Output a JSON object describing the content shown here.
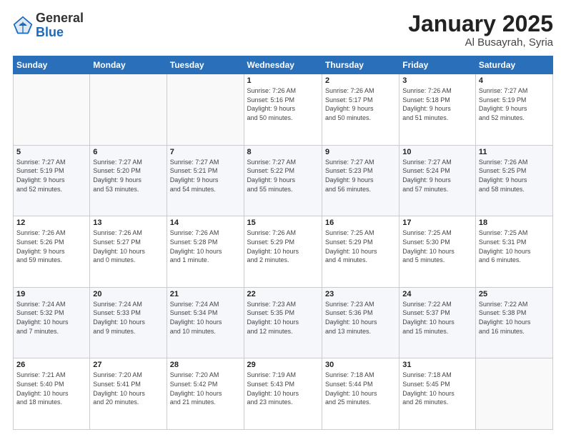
{
  "header": {
    "logo_general": "General",
    "logo_blue": "Blue",
    "title": "January 2025",
    "subtitle": "Al Busayrah, Syria"
  },
  "days_of_week": [
    "Sunday",
    "Monday",
    "Tuesday",
    "Wednesday",
    "Thursday",
    "Friday",
    "Saturday"
  ],
  "weeks": [
    [
      {
        "day": "",
        "info": ""
      },
      {
        "day": "",
        "info": ""
      },
      {
        "day": "",
        "info": ""
      },
      {
        "day": "1",
        "info": "Sunrise: 7:26 AM\nSunset: 5:16 PM\nDaylight: 9 hours\nand 50 minutes."
      },
      {
        "day": "2",
        "info": "Sunrise: 7:26 AM\nSunset: 5:17 PM\nDaylight: 9 hours\nand 50 minutes."
      },
      {
        "day": "3",
        "info": "Sunrise: 7:26 AM\nSunset: 5:18 PM\nDaylight: 9 hours\nand 51 minutes."
      },
      {
        "day": "4",
        "info": "Sunrise: 7:27 AM\nSunset: 5:19 PM\nDaylight: 9 hours\nand 52 minutes."
      }
    ],
    [
      {
        "day": "5",
        "info": "Sunrise: 7:27 AM\nSunset: 5:19 PM\nDaylight: 9 hours\nand 52 minutes."
      },
      {
        "day": "6",
        "info": "Sunrise: 7:27 AM\nSunset: 5:20 PM\nDaylight: 9 hours\nand 53 minutes."
      },
      {
        "day": "7",
        "info": "Sunrise: 7:27 AM\nSunset: 5:21 PM\nDaylight: 9 hours\nand 54 minutes."
      },
      {
        "day": "8",
        "info": "Sunrise: 7:27 AM\nSunset: 5:22 PM\nDaylight: 9 hours\nand 55 minutes."
      },
      {
        "day": "9",
        "info": "Sunrise: 7:27 AM\nSunset: 5:23 PM\nDaylight: 9 hours\nand 56 minutes."
      },
      {
        "day": "10",
        "info": "Sunrise: 7:27 AM\nSunset: 5:24 PM\nDaylight: 9 hours\nand 57 minutes."
      },
      {
        "day": "11",
        "info": "Sunrise: 7:26 AM\nSunset: 5:25 PM\nDaylight: 9 hours\nand 58 minutes."
      }
    ],
    [
      {
        "day": "12",
        "info": "Sunrise: 7:26 AM\nSunset: 5:26 PM\nDaylight: 9 hours\nand 59 minutes."
      },
      {
        "day": "13",
        "info": "Sunrise: 7:26 AM\nSunset: 5:27 PM\nDaylight: 10 hours\nand 0 minutes."
      },
      {
        "day": "14",
        "info": "Sunrise: 7:26 AM\nSunset: 5:28 PM\nDaylight: 10 hours\nand 1 minute."
      },
      {
        "day": "15",
        "info": "Sunrise: 7:26 AM\nSunset: 5:29 PM\nDaylight: 10 hours\nand 2 minutes."
      },
      {
        "day": "16",
        "info": "Sunrise: 7:25 AM\nSunset: 5:29 PM\nDaylight: 10 hours\nand 4 minutes."
      },
      {
        "day": "17",
        "info": "Sunrise: 7:25 AM\nSunset: 5:30 PM\nDaylight: 10 hours\nand 5 minutes."
      },
      {
        "day": "18",
        "info": "Sunrise: 7:25 AM\nSunset: 5:31 PM\nDaylight: 10 hours\nand 6 minutes."
      }
    ],
    [
      {
        "day": "19",
        "info": "Sunrise: 7:24 AM\nSunset: 5:32 PM\nDaylight: 10 hours\nand 7 minutes."
      },
      {
        "day": "20",
        "info": "Sunrise: 7:24 AM\nSunset: 5:33 PM\nDaylight: 10 hours\nand 9 minutes."
      },
      {
        "day": "21",
        "info": "Sunrise: 7:24 AM\nSunset: 5:34 PM\nDaylight: 10 hours\nand 10 minutes."
      },
      {
        "day": "22",
        "info": "Sunrise: 7:23 AM\nSunset: 5:35 PM\nDaylight: 10 hours\nand 12 minutes."
      },
      {
        "day": "23",
        "info": "Sunrise: 7:23 AM\nSunset: 5:36 PM\nDaylight: 10 hours\nand 13 minutes."
      },
      {
        "day": "24",
        "info": "Sunrise: 7:22 AM\nSunset: 5:37 PM\nDaylight: 10 hours\nand 15 minutes."
      },
      {
        "day": "25",
        "info": "Sunrise: 7:22 AM\nSunset: 5:38 PM\nDaylight: 10 hours\nand 16 minutes."
      }
    ],
    [
      {
        "day": "26",
        "info": "Sunrise: 7:21 AM\nSunset: 5:40 PM\nDaylight: 10 hours\nand 18 minutes."
      },
      {
        "day": "27",
        "info": "Sunrise: 7:20 AM\nSunset: 5:41 PM\nDaylight: 10 hours\nand 20 minutes."
      },
      {
        "day": "28",
        "info": "Sunrise: 7:20 AM\nSunset: 5:42 PM\nDaylight: 10 hours\nand 21 minutes."
      },
      {
        "day": "29",
        "info": "Sunrise: 7:19 AM\nSunset: 5:43 PM\nDaylight: 10 hours\nand 23 minutes."
      },
      {
        "day": "30",
        "info": "Sunrise: 7:18 AM\nSunset: 5:44 PM\nDaylight: 10 hours\nand 25 minutes."
      },
      {
        "day": "31",
        "info": "Sunrise: 7:18 AM\nSunset: 5:45 PM\nDaylight: 10 hours\nand 26 minutes."
      },
      {
        "day": "",
        "info": ""
      }
    ]
  ]
}
